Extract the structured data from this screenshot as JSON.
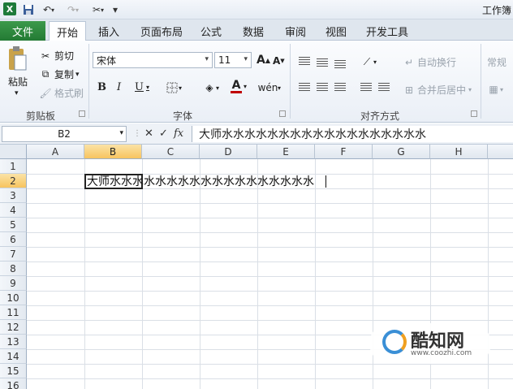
{
  "window": {
    "title": "工作簿"
  },
  "quick_access": {
    "save_icon": "save-icon",
    "undo_icon": "undo-icon",
    "redo_icon": "redo-icon",
    "customize_icon": "customize-icon"
  },
  "tabs": [
    "文件",
    "开始",
    "插入",
    "页面布局",
    "公式",
    "数据",
    "审阅",
    "视图",
    "开发工具"
  ],
  "ribbon": {
    "clipboard": {
      "paste": "粘贴",
      "cut": "剪切",
      "copy": "复制",
      "format_painter": "格式刷",
      "label": "剪贴板"
    },
    "font": {
      "name": "宋体",
      "size": "11",
      "grow": "A",
      "shrink": "A",
      "bold": "B",
      "italic": "I",
      "underline": "U",
      "label": "字体",
      "font_color": "#c00000"
    },
    "alignment": {
      "wrap": "自动换行",
      "merge": "合并后居中",
      "label": "对齐方式"
    },
    "number": {
      "format": "常规"
    }
  },
  "formula_bar": {
    "name_box": "B2",
    "cancel": "✕",
    "enter": "✓",
    "fx": "fx",
    "content": "大师水水水水水水水水水水水水水水水水水水"
  },
  "columns": [
    "A",
    "B",
    "C",
    "D",
    "E",
    "F",
    "G",
    "H"
  ],
  "rows": [
    "1",
    "2",
    "3",
    "4",
    "5",
    "6",
    "7",
    "8",
    "9",
    "10",
    "11",
    "12",
    "13",
    "14",
    "15",
    "16"
  ],
  "cells": {
    "B2": "大师水水水水水水水水水水水水水水水水水水"
  },
  "watermark": {
    "name": "酷知网",
    "url": "www.coozhi.com"
  },
  "colors": {
    "file_tab": "#237a34",
    "selection": "#f7c45f"
  }
}
